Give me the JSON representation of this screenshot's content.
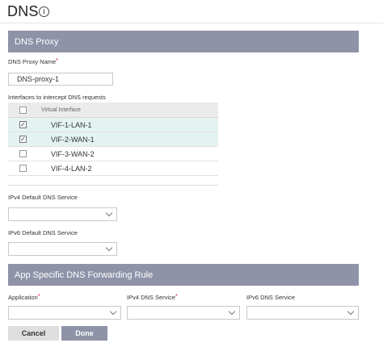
{
  "header": {
    "title": "DNS",
    "info_icon": "info-icon"
  },
  "dns_proxy_section": {
    "title": "DNS Proxy"
  },
  "proxy_name": {
    "label": "DNS Proxy Name",
    "required_marker": "*",
    "value": "DNS-proxy-1"
  },
  "interfaces": {
    "label": "Interfaces to intercept DNS requests",
    "column_header": "Virtual Interface",
    "rows": [
      {
        "name": "VIF-1-LAN-1",
        "checked": true
      },
      {
        "name": "VIF-2-WAN-1",
        "checked": true
      },
      {
        "name": "VIF-3-WAN-2",
        "checked": false
      },
      {
        "name": "VIF-4-LAN-2",
        "checked": false
      }
    ]
  },
  "ipv4_default": {
    "label": "IPv4 Default DNS Service",
    "value": ""
  },
  "ipv6_default": {
    "label": "IPv6 Default DNS Service",
    "value": ""
  },
  "app_section": {
    "title": "App Specific DNS Forwarding Rule"
  },
  "app_rule": {
    "application_label": "Application",
    "ipv4_label": "IPv4 DNS Service",
    "ipv6_label": "IPv6 DNS Service",
    "required_marker": "*"
  },
  "actions": {
    "cancel_label": "Cancel",
    "done_label": "Done"
  },
  "colors": {
    "section_bar": "#8f93a8",
    "selected_row": "#e3f3f1",
    "required": "#d0021b"
  }
}
